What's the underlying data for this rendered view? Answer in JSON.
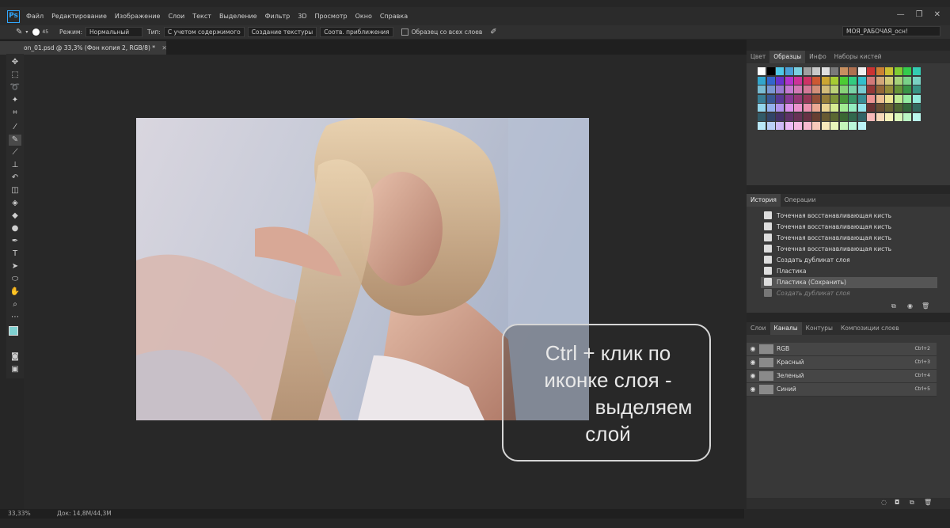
{
  "app": {
    "logo": "Ps"
  },
  "menu": [
    "Файл",
    "Редактирование",
    "Изображение",
    "Слои",
    "Текст",
    "Выделение",
    "Фильтр",
    "3D",
    "Просмотр",
    "Окно",
    "Справка"
  ],
  "window_controls": [
    "—",
    "❐",
    "✕"
  ],
  "options": {
    "brush_size": "45",
    "mode_label": "Режим:",
    "mode_value": "Нормальный",
    "type_label": "Тип:",
    "btn_content_aware": "С учетом содержимого",
    "btn_texture": "Создание текстуры",
    "btn_proximity": "Соотв. приближения",
    "sample_all_layers": "Образец со всех слоев",
    "workspace": "МОЯ_РАБОЧАЯ_осн!"
  },
  "document_tab": {
    "title": "on_01.psd @ 33,3% (Фон копия 2, RGB/8) *",
    "close": "✕"
  },
  "status": {
    "zoom": "33,33%",
    "doc_size": "Док: 14,8M/44,3M"
  },
  "swatches_panel": {
    "tabs": [
      "Цвет",
      "Образцы",
      "Инфо",
      "Наборы кистей"
    ],
    "active_tab": "Образцы",
    "colors": [
      "#ffffff",
      "#000000",
      "#4fc8e8",
      "#4aa0d8",
      "#7ad0e0",
      "#a0a0a0",
      "#c8c8c8",
      "#e0e0e0",
      "#7a7a7a",
      "#c89060",
      "#b07050",
      "#f0f0f0"
    ]
  },
  "history_panel": {
    "tabs": [
      "История",
      "Операции"
    ],
    "active_tab": "История",
    "items": [
      "Точечная восстанавливающая кисть",
      "Точечная восстанавливающая кисть",
      "Точечная восстанавливающая кисть",
      "Точечная восстанавливающая кисть",
      "Создать дубликат слоя",
      "Пластика",
      "Пластика (Сохранить)",
      "Создать дубликат слоя"
    ],
    "selected_index": 6
  },
  "channels_panel": {
    "tabs": [
      "Слои",
      "Каналы",
      "Контуры",
      "Композиции слоев"
    ],
    "active_tab": "Каналы",
    "channels": [
      {
        "name": "RGB",
        "shortcut": "Ctrl+2"
      },
      {
        "name": "Красный",
        "shortcut": "Ctrl+3"
      },
      {
        "name": "Зеленый",
        "shortcut": "Ctrl+4"
      },
      {
        "name": "Синий",
        "shortcut": "Ctrl+5"
      }
    ]
  },
  "callout": {
    "lines": [
      "Ctrl + клик по",
      "иконке слоя -",
      "выделяем",
      "слой"
    ]
  }
}
